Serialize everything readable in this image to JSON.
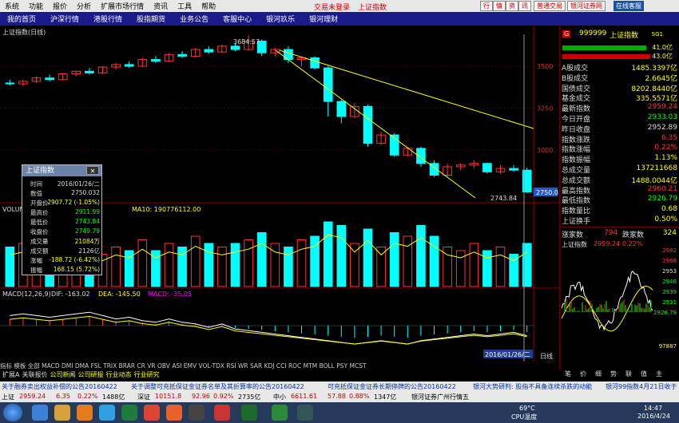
{
  "menu": {
    "items": [
      "系统",
      "功能",
      "报价",
      "分析",
      "扩展市场行情",
      "资讯",
      "工具",
      "帮助"
    ],
    "status": "交易未登录",
    "index_name": "上证指数",
    "right_buttons": [
      "行",
      "情",
      "资",
      "讯",
      "普通交易",
      "银河证券网"
    ],
    "logo": "在线客服"
  },
  "tabs": [
    "我的首页",
    "沪深行情",
    "港股行情",
    "股指期货",
    "业务公告",
    "客服中心",
    "银河玖乐",
    "银河理财"
  ],
  "chart": {
    "title": "上证指数(日线)",
    "high_label": "3684.57",
    "low_label": "2743.84",
    "price_tag": "2750.0",
    "axis_label": "日线",
    "date_box": "2016/01/26/二",
    "volume_label": "VOLUME:1074560.00",
    "ma_label": "MA10: 190776112.00",
    "macd_label": "MACD(12,26,9)",
    "dif_label": "DIF: -163.02",
    "dea_label": "DEA: -145.50",
    "macd_val": "MACD: -35.05",
    "y_ticks": [
      "3500",
      "3250",
      "3000"
    ],
    "colors": {
      "up": "#ff3333",
      "down": "#00ffff",
      "ma": "#ffff00"
    },
    "candles": [
      {
        "o": 3400,
        "h": 3420,
        "l": 3385,
        "c": 3395
      },
      {
        "o": 3395,
        "h": 3420,
        "l": 3380,
        "c": 3410
      },
      {
        "o": 3410,
        "h": 3440,
        "l": 3400,
        "c": 3430
      },
      {
        "o": 3430,
        "h": 3450,
        "l": 3410,
        "c": 3420
      },
      {
        "o": 3420,
        "h": 3460,
        "l": 3415,
        "c": 3455
      },
      {
        "o": 3455,
        "h": 3475,
        "l": 3440,
        "c": 3470
      },
      {
        "o": 3470,
        "h": 3490,
        "l": 3450,
        "c": 3460
      },
      {
        "o": 3460,
        "h": 3500,
        "l": 3455,
        "c": 3495
      },
      {
        "o": 3495,
        "h": 3520,
        "l": 3480,
        "c": 3510
      },
      {
        "o": 3510,
        "h": 3530,
        "l": 3490,
        "c": 3500
      },
      {
        "o": 3500,
        "h": 3550,
        "l": 3495,
        "c": 3540
      },
      {
        "o": 3540,
        "h": 3560,
        "l": 3520,
        "c": 3530
      },
      {
        "o": 3530,
        "h": 3580,
        "l": 3525,
        "c": 3570
      },
      {
        "o": 3570,
        "h": 3590,
        "l": 3550,
        "c": 3560
      },
      {
        "o": 3560,
        "h": 3610,
        "l": 3555,
        "c": 3600
      },
      {
        "o": 3600,
        "h": 3620,
        "l": 3575,
        "c": 3585
      },
      {
        "o": 3585,
        "h": 3630,
        "l": 3580,
        "c": 3620
      },
      {
        "o": 3620,
        "h": 3640,
        "l": 3590,
        "c": 3600
      },
      {
        "o": 3600,
        "h": 3684.57,
        "l": 3595,
        "c": 3650
      },
      {
        "o": 3650,
        "h": 3660,
        "l": 3560,
        "c": 3580
      },
      {
        "o": 3580,
        "h": 3610,
        "l": 3560,
        "c": 3600
      },
      {
        "o": 3600,
        "h": 3620,
        "l": 3520,
        "c": 3540
      },
      {
        "o": 3540,
        "h": 3560,
        "l": 3500,
        "c": 3550
      },
      {
        "o": 3550,
        "h": 3560,
        "l": 3480,
        "c": 3490
      },
      {
        "o": 3490,
        "h": 3500,
        "l": 3200,
        "c": 3290
      },
      {
        "o": 3290,
        "h": 3300,
        "l": 3160,
        "c": 3200
      },
      {
        "o": 3200,
        "h": 3280,
        "l": 3190,
        "c": 3260
      },
      {
        "o": 3260,
        "h": 3270,
        "l": 3020,
        "c": 3040
      },
      {
        "o": 3040,
        "h": 3110,
        "l": 3030,
        "c": 3090
      },
      {
        "o": 3090,
        "h": 3100,
        "l": 2960,
        "c": 2970
      },
      {
        "o": 2970,
        "h": 3020,
        "l": 2960,
        "c": 3010
      },
      {
        "o": 3010,
        "h": 3020,
        "l": 2900,
        "c": 2920
      },
      {
        "o": 2920,
        "h": 2940,
        "l": 2840,
        "c": 2850
      },
      {
        "o": 2850,
        "h": 2920,
        "l": 2840,
        "c": 2900
      },
      {
        "o": 2900,
        "h": 2920,
        "l": 2880,
        "c": 2910
      },
      {
        "o": 2910,
        "h": 2940,
        "l": 2890,
        "c": 2920
      },
      {
        "o": 2920,
        "h": 2925,
        "l": 2860,
        "c": 2870
      },
      {
        "o": 2870,
        "h": 2910,
        "l": 2860,
        "c": 2890
      },
      {
        "o": 2890,
        "h": 2910,
        "l": 2870,
        "c": 2880
      },
      {
        "o": 2880,
        "h": 2895,
        "l": 2743.84,
        "c": 2750
      }
    ],
    "volume": [
      0.55,
      0.6,
      0.5,
      0.45,
      0.55,
      0.5,
      0.6,
      0.45,
      0.55,
      0.5,
      0.65,
      0.5,
      0.6,
      0.55,
      0.7,
      0.6,
      0.55,
      0.6,
      0.65,
      0.75,
      0.6,
      0.55,
      0.65,
      0.7,
      0.9,
      0.85,
      0.6,
      0.8,
      0.55,
      0.75,
      0.7,
      0.85,
      0.7,
      0.55,
      0.5,
      0.6,
      0.5,
      0.55,
      0.45,
      0.6
    ],
    "macd": [
      0.3,
      0.35,
      0.3,
      0.25,
      0.3,
      0.35,
      0.4,
      0.3,
      0.2,
      0.25,
      0.15,
      0.1,
      0.2,
      0.1,
      0.05,
      -0.05,
      0.05,
      -0.1,
      -0.15,
      -0.2,
      -0.25,
      -0.3,
      -0.35,
      -0.4,
      -0.45,
      -0.5,
      -0.55,
      -0.5,
      -0.45,
      -0.5,
      -0.55,
      -0.45,
      -0.4,
      -0.35,
      -0.3,
      -0.25,
      -0.3,
      -0.25,
      -0.2,
      -0.3
    ]
  },
  "popup": {
    "title": "上证指数",
    "rows": [
      [
        "时间",
        "2016/01/26/二"
      ],
      [
        "数值",
        "2750.032"
      ],
      [
        "开盘价",
        "2907.72 (-1.05%)"
      ],
      [
        "最高价",
        "2911.99"
      ],
      [
        "最低价",
        "2743.84"
      ],
      [
        "收盘价",
        "2749.79"
      ],
      [
        "成交量",
        "21084万"
      ],
      [
        "成交额",
        "2126亿"
      ],
      [
        "涨幅",
        "-188.72 (-6.42%)"
      ],
      [
        "振幅",
        "168.15 (5.72%)"
      ]
    ]
  },
  "right": {
    "code": "999999",
    "name": "上证指数",
    "tag": "SG1",
    "ratios": [
      "41.0亿",
      "43.0亿"
    ],
    "rows": [
      [
        "A股成交",
        "1485.3397亿"
      ],
      [
        "B股成交",
        "2.6645亿"
      ],
      [
        "国债成交",
        "8202.8440亿"
      ],
      [
        "基金成交",
        "335.5571亿"
      ],
      [
        "最新指数",
        "2959.24"
      ],
      [
        "今日开盘",
        "2933.03"
      ],
      [
        "昨日收盘",
        "2952.89"
      ],
      [
        "指数涨跌",
        "6.35"
      ],
      [
        "指数涨幅",
        "0.22%"
      ],
      [
        "指数振幅",
        "1.13%"
      ],
      [
        "总成交量",
        "137211668"
      ],
      [
        "总成交额",
        "1488.0044亿"
      ],
      [
        "最高指数",
        "2960.21"
      ],
      [
        "最低指数",
        "2926.79"
      ],
      [
        "指数量比",
        "0.68"
      ],
      [
        "上证换手",
        "0.50%"
      ]
    ],
    "up_label": "涨家数",
    "up_count": "794",
    "down_label": "跌家数",
    "down_count": "324",
    "mini_title": "上证指数",
    "mini_price": "2959.24",
    "mini_pct": "0.22%",
    "mini_ticks": [
      "2982",
      "2968",
      "2953",
      "2946",
      "2939",
      "2931",
      "2926.79"
    ],
    "mini_bottom": "97887",
    "foot": [
      "笔",
      "价",
      "细",
      "势",
      "联",
      "值",
      "主"
    ]
  },
  "bottom_tabs": "指标 模板 全部 MACD DMI DMA FSL TRIX BRAR CR VR OBV ASI EMV VOL-TDX RSI WR SAR KDJ CCI ROC MTM BOLL PSY MCST",
  "bottom_tabs2": [
    "扩展A",
    "关联报价",
    "公司新闻",
    "公司研报",
    "行业动态",
    "行业研究"
  ],
  "ticker": [
    "关于融券卖出权益补偿的公告20160422",
    "关于调整可充抵保证金证券名单及其折算率的公告20160422",
    "可充抵保证金证券长期停牌的公告20160422",
    "银河大势研判: 股指不具备连续杀跌的动能",
    "银河99指数4月21日收于"
  ],
  "idx": [
    [
      "上证",
      "2959.24",
      "6.35",
      "0.22%",
      "1488亿"
    ],
    [
      "深证",
      "10151.8",
      "92.96",
      "0.92%",
      "2735亿"
    ],
    [
      "中小",
      "6611.61",
      "57.88",
      "0.88%",
      "1347亿"
    ]
  ],
  "idx_broker": "银河证券广州行情五",
  "taskbar": {
    "temp": "69°C",
    "cpu": "CPU温度",
    "time": "14:47",
    "date": "2016/4/24"
  }
}
